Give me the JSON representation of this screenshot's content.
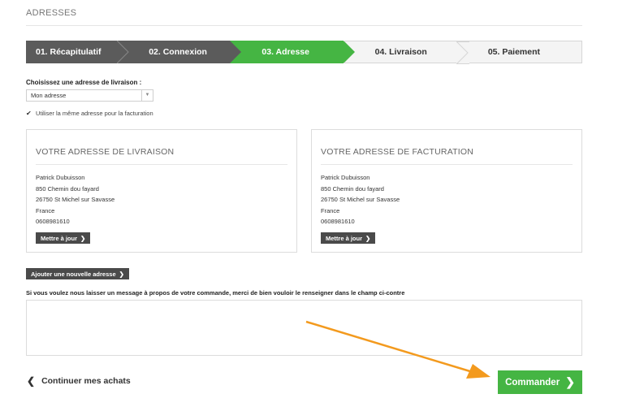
{
  "page": {
    "title": "ADRESSES"
  },
  "steps": [
    {
      "label": "01. Récapitulatif",
      "state": "done"
    },
    {
      "label": "02. Connexion",
      "state": "done"
    },
    {
      "label": "03. Adresse",
      "state": "active"
    },
    {
      "label": "04. Livraison",
      "state": "todo"
    },
    {
      "label": "05. Paiement",
      "state": "todo"
    }
  ],
  "delivery_select": {
    "label": "Choisissez une adresse de livraison :",
    "value": "Mon adresse"
  },
  "same_address": {
    "label": "Utiliser la même adresse pour la facturation",
    "checked": true
  },
  "delivery_address": {
    "title": "VOTRE ADRESSE DE LIVRAISON",
    "lines": [
      "Patrick Dubuisson",
      "850 Chemin dou fayard",
      "26750 St Michel sur Savasse",
      "France",
      "0608981610"
    ],
    "update_label": "Mettre à jour"
  },
  "billing_address": {
    "title": "VOTRE ADRESSE DE FACTURATION",
    "lines": [
      "Patrick Dubuisson",
      "850 Chemin dou fayard",
      "26750 St Michel sur Savasse",
      "France",
      "0608981610"
    ],
    "update_label": "Mettre à jour"
  },
  "add_address_label": "Ajouter une nouvelle adresse",
  "message": {
    "label": "Si vous voulez nous laisser un message à propos de votre commande, merci de bien vouloir le renseigner dans le champ ci-contre",
    "value": ""
  },
  "continue_label": "Continuer mes achats",
  "order_label": "Commander",
  "colors": {
    "green": "#45b543",
    "dark": "#5b5b5b",
    "annotation_arrow": "#f39a1e"
  }
}
